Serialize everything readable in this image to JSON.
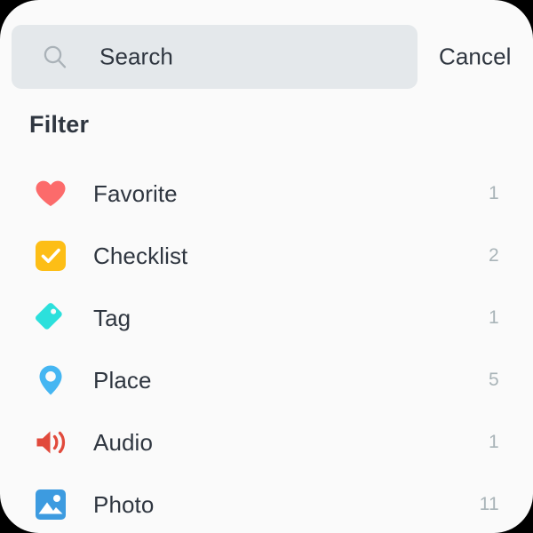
{
  "search": {
    "icon": "search-icon",
    "value": "Search",
    "placeholder": "Search",
    "cancel_label": "Cancel",
    "field_background": "#E4E8EB"
  },
  "section": {
    "heading": "Filter"
  },
  "filters": [
    {
      "icon": "heart-icon",
      "label": "Favorite",
      "count": "1",
      "color": "#FC6B6B"
    },
    {
      "icon": "checkbox-icon",
      "label": "Checklist",
      "count": "2",
      "color": "#FDBE16"
    },
    {
      "icon": "tag-icon",
      "label": "Tag",
      "count": "1",
      "color": "#2CE0DC"
    },
    {
      "icon": "map-pin-icon",
      "label": "Place",
      "count": "5",
      "color": "#45B6F2"
    },
    {
      "icon": "audio-icon",
      "label": "Audio",
      "count": "1",
      "color": "#E14A3C"
    },
    {
      "icon": "photo-icon",
      "label": "Photo",
      "count": "11",
      "color": "#3D9BE0"
    }
  ],
  "theme": {
    "card_background": "#FAFAFA",
    "backdrop": "#000000",
    "text_primary": "#2F3640",
    "text_muted": "#A9B4B8"
  }
}
